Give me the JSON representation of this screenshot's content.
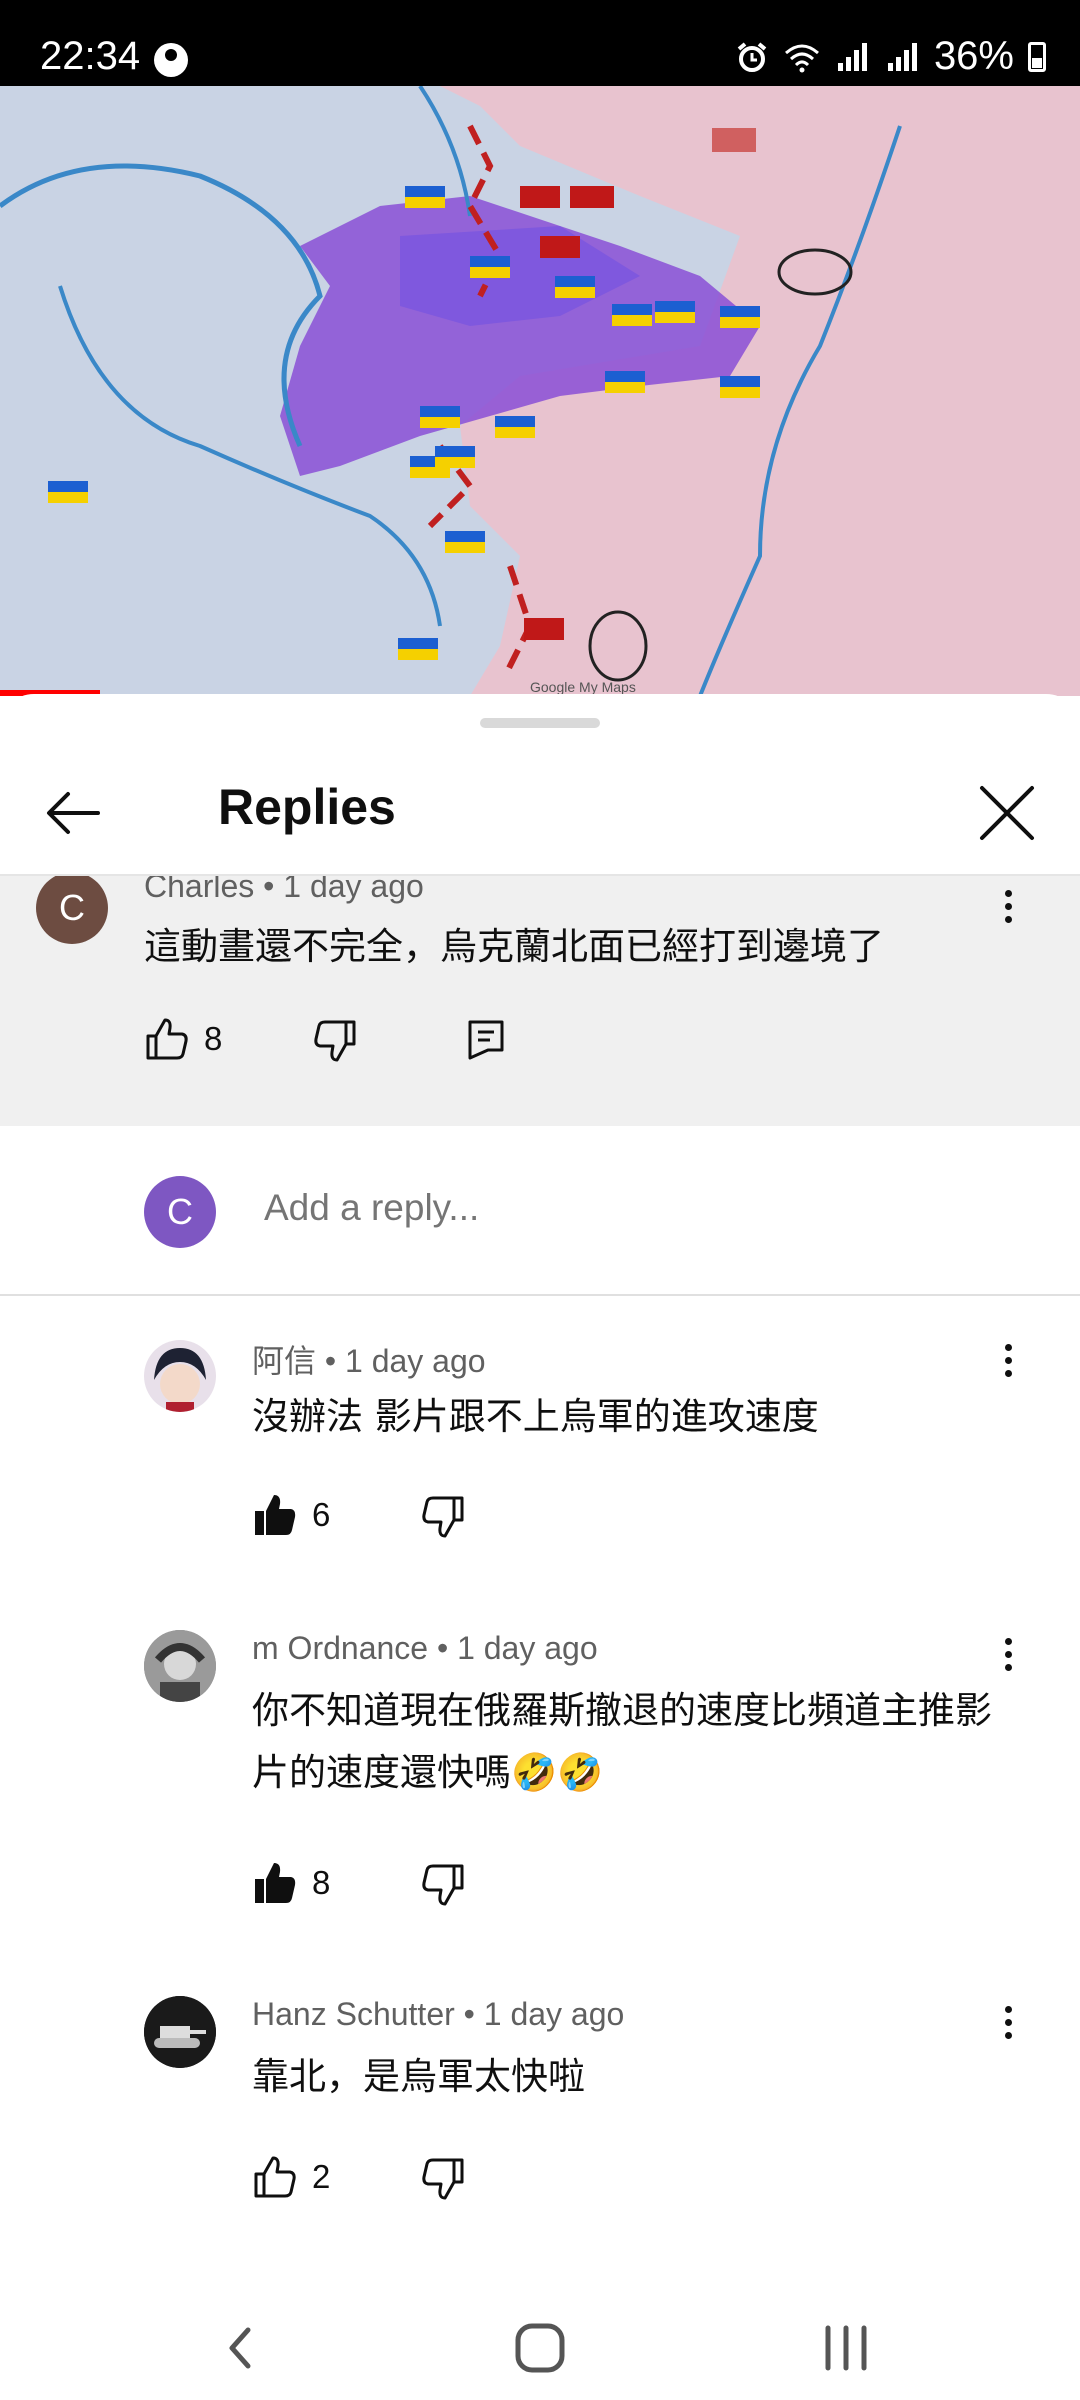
{
  "status_bar": {
    "time": "22:34",
    "battery": "36%"
  },
  "video": {
    "map_labels": [
      "Google My Maps"
    ]
  },
  "sheet": {
    "title": "Replies"
  },
  "parent_comment": {
    "author": "Charles",
    "age": "1 day ago",
    "avatar_letter": "C",
    "avatar_color": "#6d4c41",
    "text": "這動畫還不完全，烏克蘭北面已經打到邊境了",
    "likes": "8"
  },
  "reply_composer": {
    "avatar_letter": "C",
    "avatar_color": "#7e57c2",
    "placeholder": "Add a reply..."
  },
  "replies": [
    {
      "author": "阿信",
      "age": "1 day ago",
      "text": "沒辦法 影片跟不上烏軍的進攻速度",
      "likes": "6",
      "liked": true
    },
    {
      "author": "m Ordnance",
      "age": "1 day ago",
      "text": "你不知道現在俄羅斯撤退的速度比頻道主推影片的速度還快嗎🤣🤣",
      "likes": "8",
      "liked": true
    },
    {
      "author": "Hanz Schutter",
      "age": "1 day ago",
      "text": "靠北，是烏軍太快啦",
      "likes": "2",
      "liked": false
    }
  ],
  "colors": {
    "progress": "#ff0000",
    "occupied_region": "#8a4fd6",
    "background_map": "#e8c3cf"
  }
}
